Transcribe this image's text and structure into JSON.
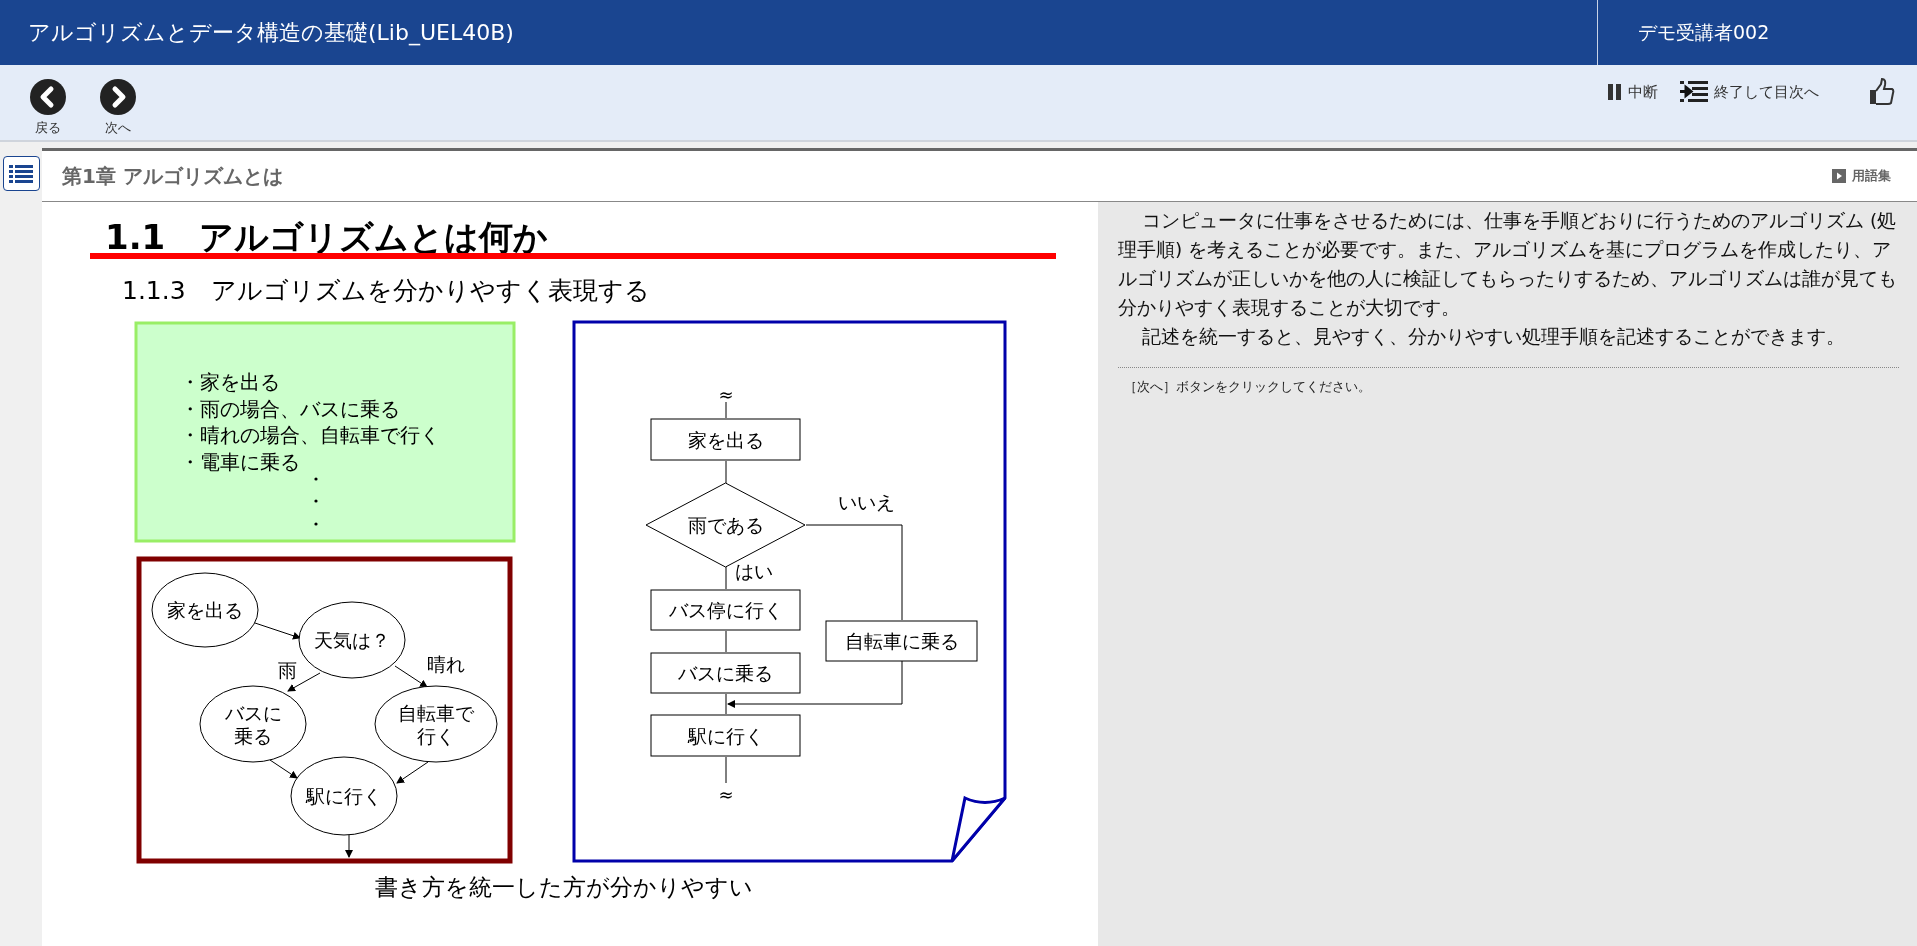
{
  "header": {
    "title": "アルゴリズムとデータ構造の基礎(Lib_UEL40B)",
    "user": "デモ受講者002"
  },
  "toolbar": {
    "back": "戻る",
    "next": "次へ",
    "pause": "中断",
    "exit": "終了して目次へ"
  },
  "chapter": {
    "title": "第1章 アルゴリズムとは",
    "glossary": "用語集"
  },
  "slide": {
    "heading": "1.1　アルゴリズムとは何か",
    "subheading": "1.1.3　アルゴリズムを分かりやすく表現する",
    "list_items": [
      "・家を出る",
      "・雨の場合、バスに乗る",
      "・晴れの場合、自転車で行く",
      "・電車に乗る"
    ],
    "bubble_nodes": [
      {
        "lines": [
          "家を出る"
        ]
      },
      {
        "lines": [
          "天気は？"
        ]
      },
      {
        "lines": [
          "バスに",
          "乗る"
        ]
      },
      {
        "lines": [
          "自転車で",
          "行く"
        ]
      },
      {
        "lines": [
          "駅に行く"
        ]
      }
    ],
    "bubble_labels": [
      "雨",
      "晴れ"
    ],
    "flow_nodes": [
      {
        "kind": "cut",
        "label": "≈"
      },
      {
        "kind": "process",
        "label": "家を出る"
      },
      {
        "kind": "decision",
        "label": "雨である"
      },
      {
        "kind": "process",
        "label": "バス停に行く"
      },
      {
        "kind": "process",
        "label": "バスに乗る"
      },
      {
        "kind": "process",
        "label": "自転車に乗る"
      },
      {
        "kind": "process",
        "label": "駅に行く"
      },
      {
        "kind": "cut",
        "label": "≈"
      }
    ],
    "flow_labels": [
      "いいえ",
      "はい"
    ],
    "caption": "書き方を統一した方が分かりやすい"
  },
  "explanation": {
    "paragraphs": [
      "コンピュータに仕事をさせるためには、仕事を手順どおりに行うためのアルゴリズム (処理手順) を考えることが必要です。また、アルゴリズムを基にプログラムを作成したり、アルゴリズムが正しいかを他の人に検証してもらったりするため、アルゴリズムは誰が見ても分かりやすく表現することが大切です。",
      "記述を統一すると、見やすく、分かりやすい処理手順を記述することができます。"
    ],
    "instruction": "［次へ］ボタンをクリックしてください。"
  }
}
